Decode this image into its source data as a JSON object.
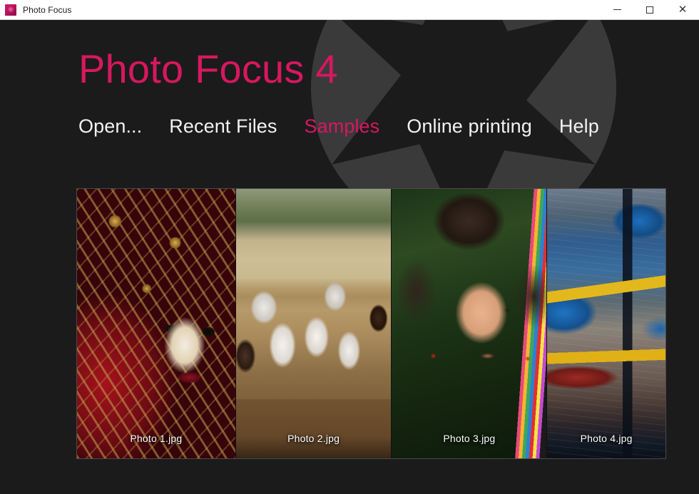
{
  "window": {
    "title": "Photo Focus",
    "icon": "app-logo-icon",
    "controls": {
      "minimize": {
        "name": "minimize-button",
        "glyph": "–"
      },
      "maximize": {
        "name": "maximize-button",
        "glyph": "□"
      },
      "close": {
        "name": "close-button",
        "glyph": "✕"
      }
    }
  },
  "hero": {
    "title": "Photo Focus 4",
    "accent_color": "#d6185f",
    "background_color": "#1b1b1b",
    "watermark": "camera-aperture-icon"
  },
  "nav": {
    "items": [
      {
        "label": "Open...",
        "active": false
      },
      {
        "label": "Recent Files",
        "active": false
      },
      {
        "label": "Samples",
        "active": true
      },
      {
        "label": "Online printing",
        "active": false
      },
      {
        "label": "Help",
        "active": false
      }
    ]
  },
  "gallery": {
    "thumbnails": [
      {
        "caption": "Photo 1.jpg",
        "subject": "venetian-carnival-mask"
      },
      {
        "caption": "Photo 2.jpg",
        "subject": "white-horses-running"
      },
      {
        "caption": "Photo 3.jpg",
        "subject": "girl-portrait"
      },
      {
        "caption": "Photo 4.jpg",
        "subject": "fishing-boats"
      }
    ]
  }
}
